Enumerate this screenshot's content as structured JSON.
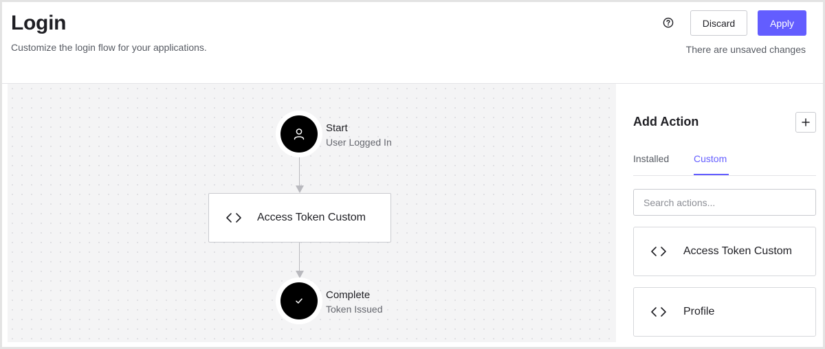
{
  "header": {
    "title": "Login",
    "subtitle": "Customize the login flow for your applications.",
    "help_icon": "question-circle-icon",
    "discard_label": "Discard",
    "apply_label": "Apply",
    "unsaved_text": "There are unsaved changes",
    "accent_color": "#635dff"
  },
  "flow": {
    "start": {
      "title": "Start",
      "subtitle": "User Logged In",
      "icon": "user-icon"
    },
    "actions": [
      {
        "label": "Access Token Custom",
        "icon": "code-icon"
      }
    ],
    "complete": {
      "title": "Complete",
      "subtitle": "Token Issued",
      "icon": "check-icon"
    }
  },
  "panel": {
    "title": "Add Action",
    "add_icon": "plus-icon",
    "tabs": [
      {
        "label": "Installed",
        "active": false
      },
      {
        "label": "Custom",
        "active": true
      }
    ],
    "search_placeholder": "Search actions...",
    "items": [
      {
        "label": "Access Token Custom",
        "icon": "code-icon"
      },
      {
        "label": "Profile",
        "icon": "code-icon"
      }
    ]
  }
}
